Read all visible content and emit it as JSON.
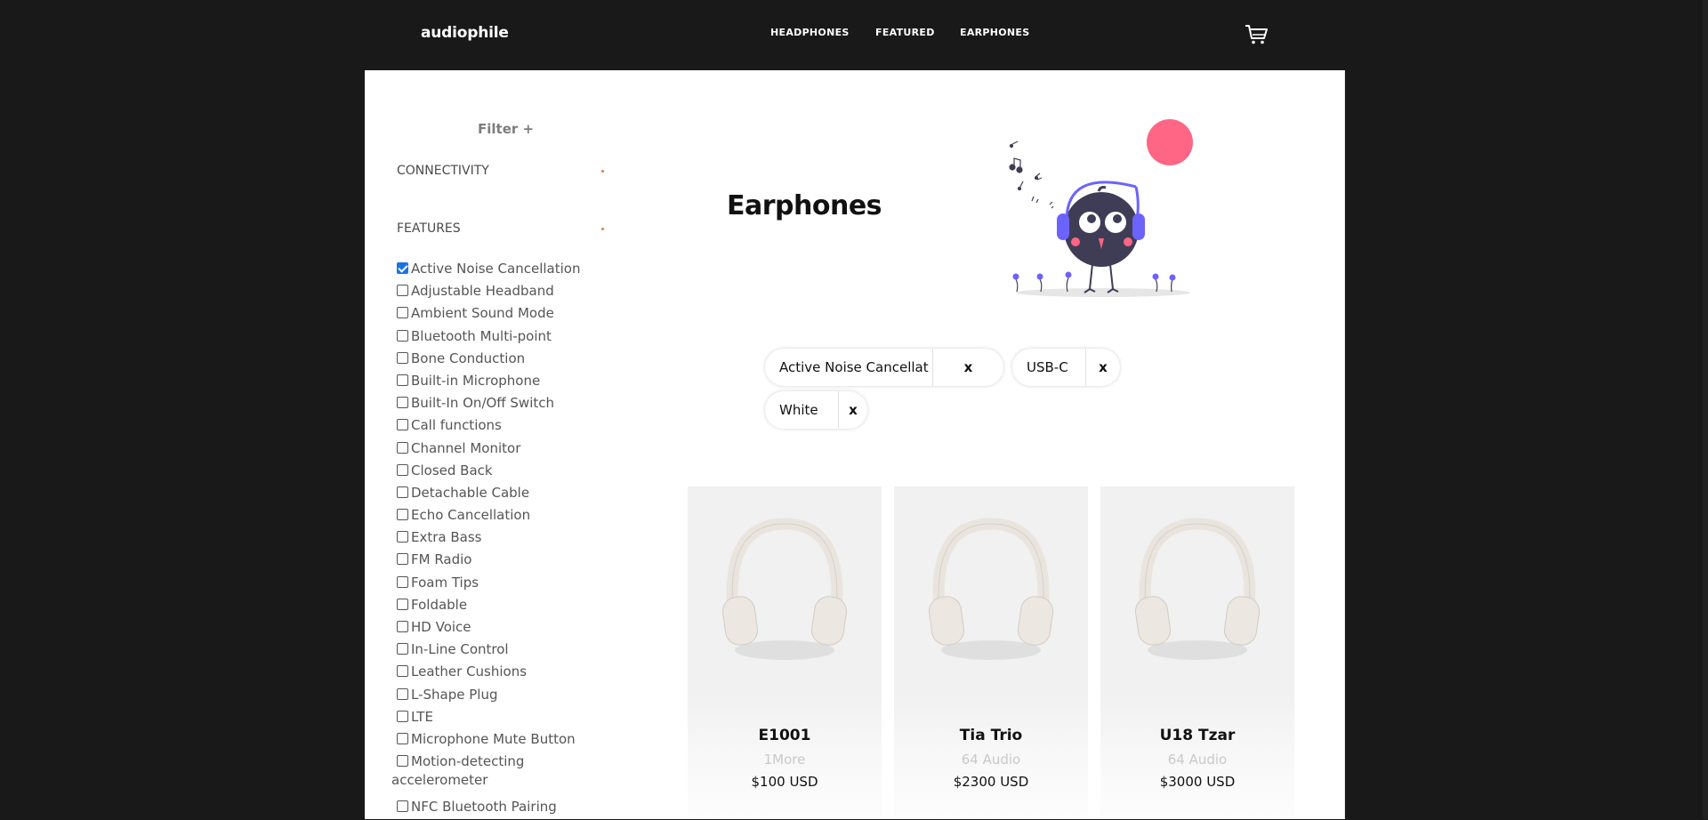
{
  "nav": {
    "logo": "audiophile",
    "links": [
      "HEADPHONES",
      "FEATURED",
      "EARPHONES"
    ],
    "cart_icon": "cart-icon"
  },
  "filter": {
    "title": "Filter +",
    "sections": [
      "CONNECTIVITY",
      "FEATURES"
    ],
    "options": [
      {
        "label": "Active Noise Cancellation",
        "checked": true
      },
      {
        "label": "Adjustable Headband",
        "checked": false
      },
      {
        "label": "Ambient Sound Mode",
        "checked": false
      },
      {
        "label": "Bluetooth Multi-point",
        "checked": false
      },
      {
        "label": "Bone Conduction",
        "checked": false
      },
      {
        "label": "Built-in Microphone",
        "checked": false
      },
      {
        "label": "Built-In On/Off Switch",
        "checked": false
      },
      {
        "label": "Call functions",
        "checked": false
      },
      {
        "label": "Channel Monitor",
        "checked": false
      },
      {
        "label": "Closed Back",
        "checked": false
      },
      {
        "label": "Detachable Cable",
        "checked": false
      },
      {
        "label": "Echo Cancellation",
        "checked": false
      },
      {
        "label": "Extra Bass",
        "checked": false
      },
      {
        "label": "FM Radio",
        "checked": false
      },
      {
        "label": "Foam Tips",
        "checked": false
      },
      {
        "label": "Foldable",
        "checked": false
      },
      {
        "label": "HD Voice",
        "checked": false
      },
      {
        "label": "In-Line Control",
        "checked": false
      },
      {
        "label": "Leather Cushions",
        "checked": false
      },
      {
        "label": "L-Shape Plug",
        "checked": false
      },
      {
        "label": "LTE",
        "checked": false
      },
      {
        "label": "Microphone Mute Button",
        "checked": false
      },
      {
        "label": "Motion-detecting",
        "label_cont": "accelerometer",
        "checked": false
      },
      {
        "label": "NFC Bluetooth Pairing",
        "checked": false
      }
    ]
  },
  "main": {
    "title": "Earphones",
    "illustration": "bird-with-headphones-illustration",
    "chips": [
      "Active Noise Cancellat",
      "USB-C",
      "White"
    ],
    "chip_remove": "x"
  },
  "products": [
    {
      "name": "E1001",
      "brand": "1More",
      "price": "$100 USD"
    },
    {
      "name": "Tia Trio",
      "brand": "64 Audio",
      "price": "$2300 USD"
    },
    {
      "name": "U18 Tzar",
      "brand": "64 Audio",
      "price": "$3000 USD"
    }
  ],
  "colors": {
    "accent": "#d87d4a",
    "nav_bg": "#191919",
    "checkbox": "#1a73e8",
    "sun": "#ff6584",
    "headphone": "#6c63ff"
  }
}
